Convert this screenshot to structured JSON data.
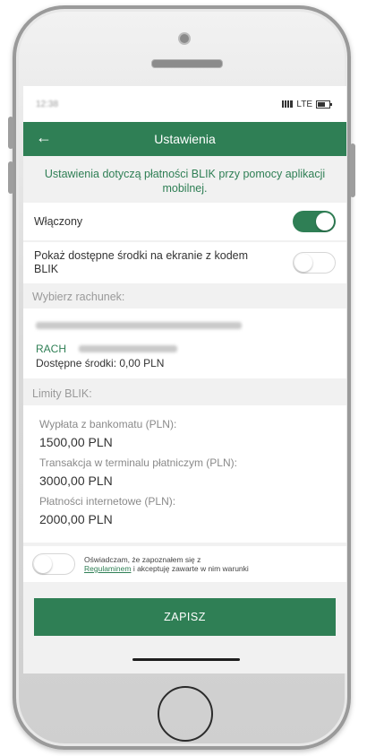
{
  "status_bar": {
    "time": "12:38",
    "network": "LTE"
  },
  "header": {
    "title": "Ustawienia",
    "back_icon": "arrow-left-icon"
  },
  "info_text": "Ustawienia dotyczą płatności BLIK przy pomocy aplikacji mobilnej.",
  "toggles": {
    "enabled": {
      "label": "Włączony",
      "state": "on"
    },
    "show_funds": {
      "label": "Pokaż dostępne środki na ekranie z kodem BLIK",
      "state": "off"
    }
  },
  "account": {
    "section_label": "Wybierz rachunek:",
    "name": "RACH",
    "funds_text": "Dostępne środki: 0,00 PLN"
  },
  "limits": {
    "section_label": "Limity BLIK:",
    "atm_label": "Wypłata z bankomatu (PLN):",
    "atm_value": "1500,00 PLN",
    "terminal_label": "Transakcja w terminalu płatniczym (PLN):",
    "terminal_value": "3000,00 PLN",
    "internet_label": "Płatności internetowe (PLN):",
    "internet_value": "2000,00 PLN"
  },
  "consent": {
    "text_before": "Oświadczam, że zapoznałem się z",
    "link": "Regulaminem",
    "text_after": "i akceptuję zawarte w nim warunki",
    "state": "off"
  },
  "save_button": {
    "label": "ZAPISZ"
  },
  "colors": {
    "brand_green": "#2f7f55",
    "screen_bg": "#f1f1f1"
  }
}
